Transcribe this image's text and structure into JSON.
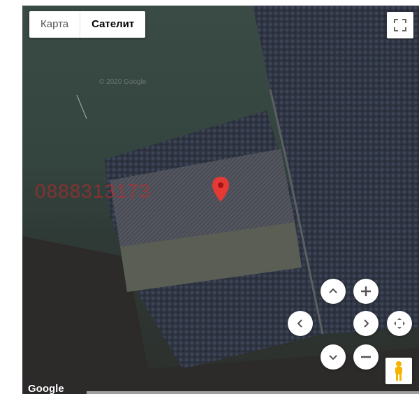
{
  "map_type": {
    "map_label": "Карта",
    "satellite_label": "Сателит",
    "active": "satellite"
  },
  "watermark": {
    "phone": "0888313173",
    "faint_text": "© 2020 Google"
  },
  "brand": {
    "logo": "Google"
  },
  "controls": {
    "fullscreen_icon": "fullscreen-icon",
    "pan_up_icon": "chevron-up-icon",
    "pan_down_icon": "chevron-down-icon",
    "pan_left_icon": "chevron-left-icon",
    "pan_right_icon": "chevron-right-icon",
    "zoom_in_icon": "plus-icon",
    "zoom_out_icon": "minus-icon",
    "recenter_icon": "recenter-icon",
    "pegman_icon": "pegman-icon"
  },
  "colors": {
    "marker": "#e53935",
    "pegman": "#f5b400",
    "field": "#3a4a44",
    "forest": "#2e3441"
  }
}
